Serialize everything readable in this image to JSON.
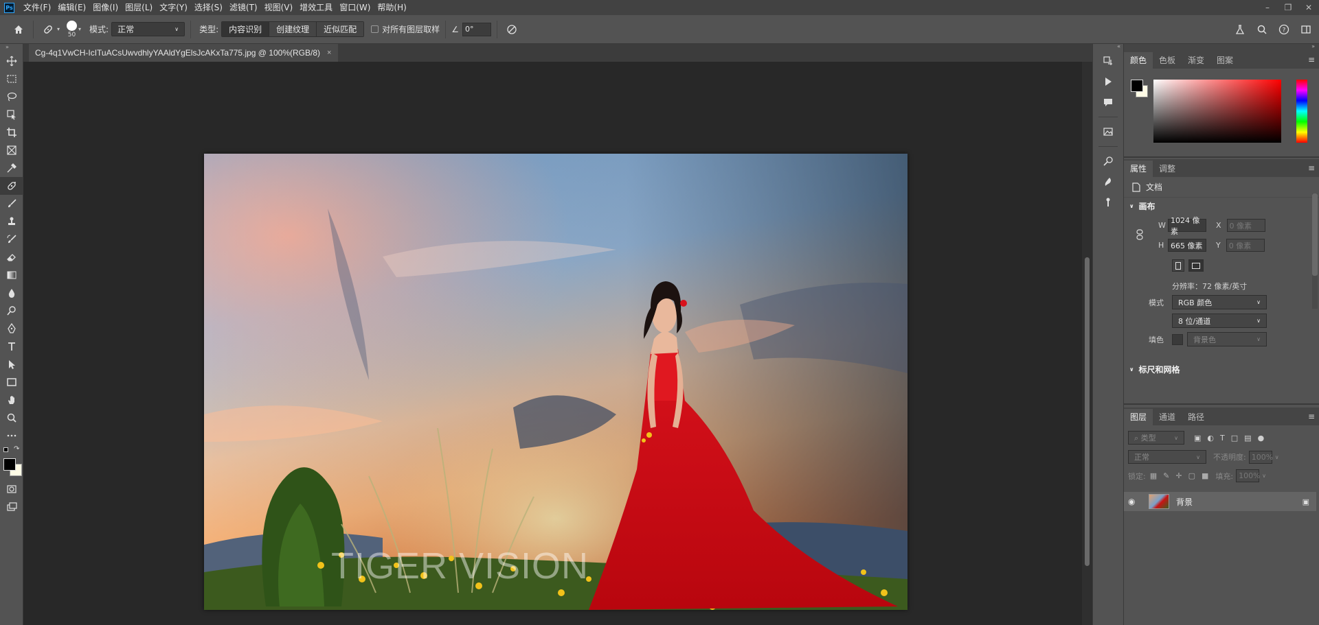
{
  "menubar": {
    "logo": "Ps",
    "items": [
      "文件(F)",
      "编辑(E)",
      "图像(I)",
      "图层(L)",
      "文字(Y)",
      "选择(S)",
      "滤镜(T)",
      "视图(V)",
      "增效工具",
      "窗口(W)",
      "帮助(H)"
    ]
  },
  "options": {
    "brush_size": "50",
    "mode_label": "模式:",
    "mode_value": "正常",
    "type_label": "类型:",
    "type_buttons": [
      "内容识别",
      "创建纹理",
      "近似匹配"
    ],
    "sample_all_label": "对所有图层取样",
    "angle_value": "0°"
  },
  "document": {
    "tab_title": "Cg-4q1VwCH-IcITuACsUwvdhlyYAAldYgElsJcAKxTa775.jpg @ 100%(RGB/8)",
    "close": "×",
    "watermark": "TIGER VISION"
  },
  "color_panel": {
    "tabs": [
      "颜色",
      "色板",
      "渐变",
      "图案"
    ],
    "foreground": "#000000",
    "background": "#fffce6"
  },
  "properties_panel": {
    "tabs": [
      "属性",
      "调整"
    ],
    "doc_label": "文档",
    "canvas_section": "画布",
    "w_label": "W",
    "w_value": "1024 像素",
    "h_label": "H",
    "h_value": "665 像素",
    "x_label": "X",
    "x_placeholder": "0 像素",
    "y_label": "Y",
    "y_placeholder": "0 像素",
    "resolution": "分辨率：72 像素/英寸",
    "mode_label": "模式",
    "mode_value": "RGB 颜色",
    "depth_value": "8 位/通道",
    "fill_label": "填色",
    "fill_value": "背景色",
    "rulers_section": "标尺和网格"
  },
  "layers_panel": {
    "tabs": [
      "图层",
      "通道",
      "路径"
    ],
    "filter_placeholder": "类型",
    "blend_mode": "正常",
    "opacity_label": "不透明度:",
    "opacity_value": "100%",
    "lock_label": "锁定:",
    "fill_label": "填充:",
    "fill_value": "100%",
    "layer_name": "背景"
  }
}
